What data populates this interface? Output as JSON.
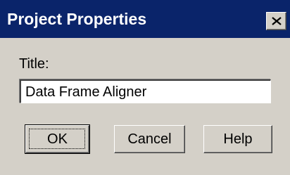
{
  "window": {
    "title": "Project Properties",
    "close_glyph": "✕",
    "titlebar_color": "#0a246a",
    "face_color": "#d4d0c8"
  },
  "form": {
    "title_label": "Title:",
    "title_value": "Data Frame Aligner"
  },
  "buttons": {
    "ok_label": "OK",
    "cancel_label": "Cancel",
    "help_label": "Help"
  },
  "icons": {
    "close": "close-icon"
  }
}
